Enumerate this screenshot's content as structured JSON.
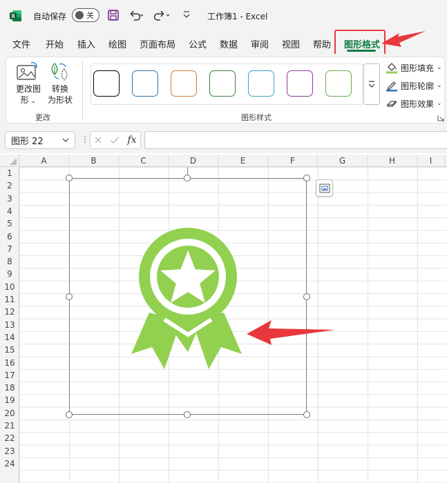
{
  "titlebar": {
    "autosave_label": "自动保存",
    "autosave_state": "关",
    "document_title": "工作簿1  -  Excel"
  },
  "tabs": [
    {
      "label": "文件"
    },
    {
      "label": "开始"
    },
    {
      "label": "插入"
    },
    {
      "label": "绘图"
    },
    {
      "label": "页面布局"
    },
    {
      "label": "公式"
    },
    {
      "label": "数据"
    },
    {
      "label": "审阅"
    },
    {
      "label": "视图"
    },
    {
      "label": "帮助"
    },
    {
      "label": "图形格式",
      "active": true
    }
  ],
  "ribbon": {
    "change_shape_line1": "更改图",
    "change_shape_line2": "形",
    "convert_line1": "转换",
    "convert_line2": "为形状",
    "group_change": "更改",
    "group_styles": "图形样式",
    "fill_label": "图形填充",
    "outline_label": "图形轮廓",
    "effects_label": "图形效果",
    "style_colors": [
      "#000000",
      "#2f6f9f",
      "#d07b35",
      "#3f7f3f",
      "#3aa3c8",
      "#8a3a9a",
      "#6aa84f"
    ]
  },
  "formula_bar": {
    "name_box_value": "图形 22",
    "fx_label": "fx",
    "formula_value": ""
  },
  "columns": [
    "A",
    "B",
    "C",
    "D",
    "E",
    "F",
    "G",
    "H",
    "I"
  ],
  "rows": [
    "1",
    "2",
    "3",
    "4",
    "5",
    "6",
    "7",
    "8",
    "9",
    "10",
    "11",
    "12",
    "13",
    "14",
    "15",
    "16",
    "17",
    "18",
    "19",
    "20",
    "21",
    "22",
    "23",
    "24"
  ],
  "colors": {
    "accent": "#107c41",
    "icon_green": "#92d050",
    "annotation_red": "#e8383d"
  }
}
